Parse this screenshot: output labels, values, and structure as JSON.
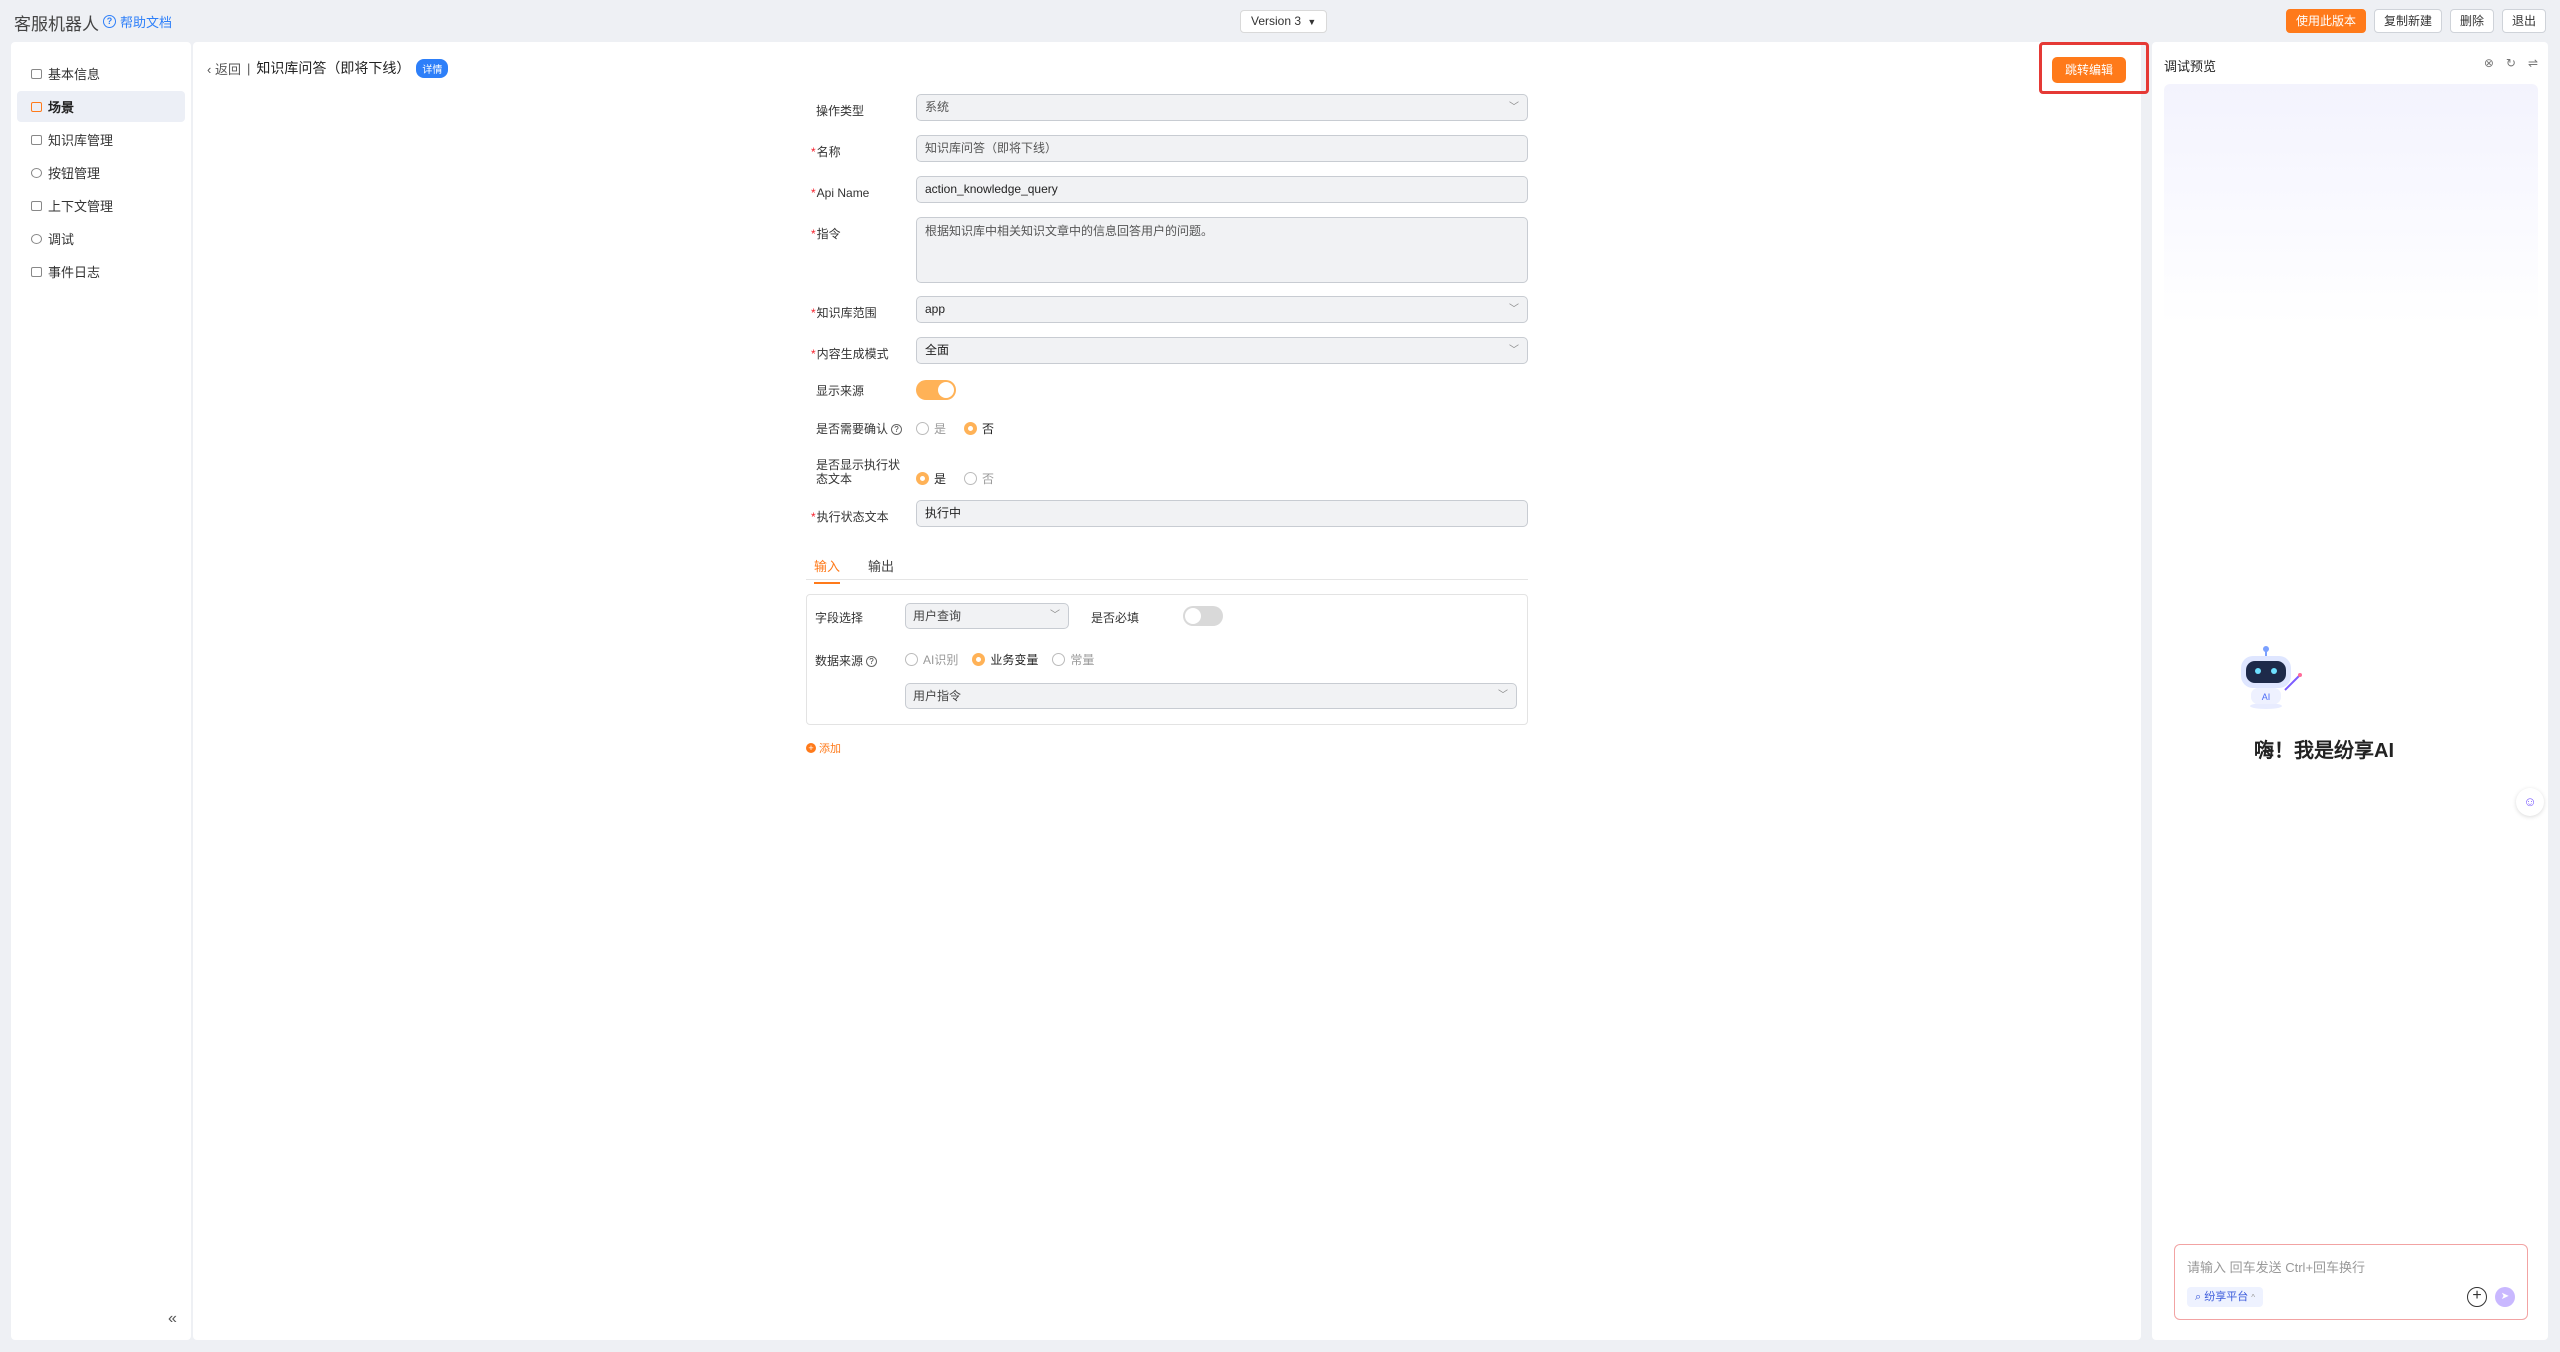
{
  "header": {
    "app_title": "客服机器人",
    "help_label": "帮助文档",
    "version_label": "Version 3",
    "actions": {
      "use_version": "使用此版本",
      "copy_new": "复制新建",
      "delete": "删除",
      "exit": "退出"
    },
    "accent_color": "#ff7a1a"
  },
  "sidebar": {
    "items": [
      {
        "label": "基本信息",
        "active": false
      },
      {
        "label": "场景",
        "active": true
      },
      {
        "label": "知识库管理",
        "active": false
      },
      {
        "label": "按钮管理",
        "active": false
      },
      {
        "label": "上下文管理",
        "active": false
      },
      {
        "label": "调试",
        "active": false
      },
      {
        "label": "事件日志",
        "active": false
      }
    ],
    "collapse_glyph": "«"
  },
  "main": {
    "back_label": "返回",
    "page_title": "知识库问答（即将下线）",
    "badge": "详情",
    "jump_edit_label": "跳转编辑",
    "form": {
      "op_type": {
        "label": "操作类型",
        "value": "系统"
      },
      "name": {
        "label": "名称",
        "value": "知识库问答（即将下线）"
      },
      "api_name": {
        "label": "Api Name",
        "value": "action_knowledge_query"
      },
      "instruction": {
        "label": "指令",
        "value": "根据知识库中相关知识文章中的信息回答用户的问题。"
      },
      "kb_scope": {
        "label": "知识库范围",
        "value": "app"
      },
      "gen_mode": {
        "label": "内容生成模式",
        "value": "全面"
      },
      "show_source": {
        "label": "显示来源",
        "on": true
      },
      "need_confirm": {
        "label": "是否需要确认",
        "options": [
          "是",
          "否"
        ],
        "selected": "否"
      },
      "show_exec_status": {
        "label": "是否显示执行状态文本",
        "options": [
          "是",
          "否"
        ],
        "selected": "是"
      },
      "exec_status_text": {
        "label": "执行状态文本",
        "value": "执行中"
      }
    },
    "tabs": [
      "输入",
      "输出"
    ],
    "io": {
      "field_select": {
        "label": "字段选择",
        "value": "用户查询"
      },
      "required": {
        "label": "是否必填",
        "on": false
      },
      "data_source": {
        "label": "数据来源",
        "options": [
          "AI识别",
          "业务变量",
          "常量"
        ],
        "selected": "业务变量"
      },
      "variable": {
        "value": "用户指令"
      }
    },
    "add_label": "添加"
  },
  "preview": {
    "title": "调试预览",
    "greeting": "嗨！我是纷享AI",
    "robot_label": "AI",
    "input_placeholder": "请输入 回车发送 Ctrl+回车换行",
    "chip_label": "纷享平台"
  }
}
